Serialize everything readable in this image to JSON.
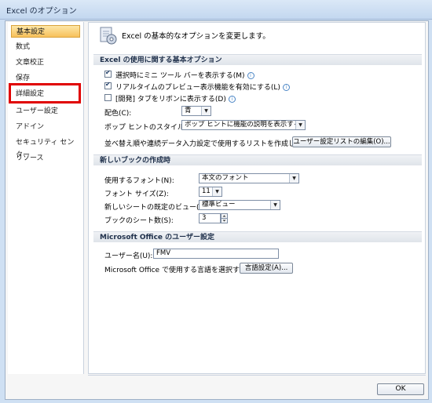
{
  "window": {
    "title": "Excel のオプション"
  },
  "sidebar": {
    "items": [
      {
        "label": "基本設定",
        "active": true
      },
      {
        "label": "数式"
      },
      {
        "label": "文章校正"
      },
      {
        "label": "保存"
      },
      {
        "label": "詳細設定",
        "highlighted": true
      },
      {
        "label": "ユーザー設定"
      },
      {
        "label": "アドイン"
      },
      {
        "label": "セキュリティ センター"
      },
      {
        "label": "リソース"
      }
    ]
  },
  "header": {
    "text": "Excel の基本的なオプションを変更します。"
  },
  "section1": {
    "title": "Excel の使用に関する基本オプション",
    "opt1": "選択時にミニ ツール バーを表示する(M)",
    "opt2": "リアルタイムのプレビュー表示機能を有効にする(L)",
    "opt3": "[開発] タブをリボンに表示する(D)",
    "color_label": "配色(C):",
    "color_value": "青",
    "tooltip_label": "ポップ ヒントのスタイル(R):",
    "tooltip_value": "ポップ ヒントに機能の説明を表示する",
    "list_label": "並べ替え順や連続データ入力設定で使用するリストを作成します:",
    "list_button": "ユーザー設定リストの編集(O)..."
  },
  "section2": {
    "title": "新しいブックの作成時",
    "font_label": "使用するフォント(N):",
    "font_value": "本文のフォント",
    "size_label": "フォント サイズ(Z):",
    "size_value": "11",
    "view_label": "新しいシートの既定のビュー(V):",
    "view_value": "標準ビュー",
    "sheets_label": "ブックのシート数(S):",
    "sheets_value": "3"
  },
  "section3": {
    "title": "Microsoft Office のユーザー設定",
    "user_label": "ユーザー名(U):",
    "user_value": "FMV",
    "lang_label": "Microsoft Office で使用する言語を選択する",
    "lang_button": "言語設定(A)..."
  },
  "footer": {
    "ok": "OK"
  }
}
